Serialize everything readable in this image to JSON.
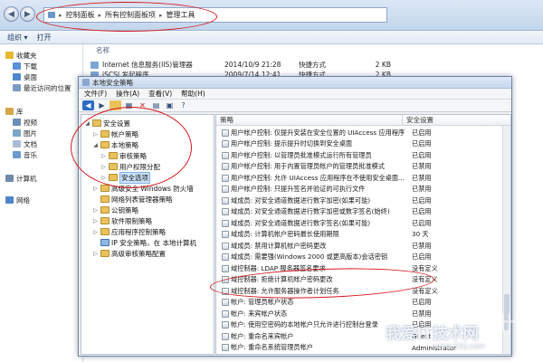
{
  "explorer": {
    "breadcrumb": [
      "控制面板",
      "所有控制面板项",
      "管理工具"
    ],
    "toolbar": {
      "organize": "组织 ▾",
      "open": "打开"
    },
    "nav": [
      {
        "label": "收藏夹",
        "color": "#e6b830"
      },
      {
        "label": "下载",
        "color": "#5b8fd6"
      },
      {
        "label": "桌面",
        "color": "#4f87cc"
      },
      {
        "label": "最近访问的位置",
        "color": "#7a9cc4"
      },
      {
        "label": "库",
        "color": "#d6a64a"
      },
      {
        "label": "视频",
        "color": "#6a8fb8"
      },
      {
        "label": "图片",
        "color": "#7aa6c8"
      },
      {
        "label": "文档",
        "color": "#a9bcd3"
      },
      {
        "label": "音乐",
        "color": "#6b9ad0"
      },
      {
        "label": "计算机",
        "color": "#6f8aa8"
      },
      {
        "label": "网络",
        "color": "#4e86c6"
      }
    ],
    "file_header": "名称",
    "files": [
      {
        "name": "Internet 信息服务(IIS)管理器",
        "date": "2014/10/9 21:28",
        "type": "快捷方式",
        "size": "2 KB"
      },
      {
        "name": "iSCSI 发起程序",
        "date": "2009/7/14 12:41",
        "type": "快捷方式",
        "size": "2 KB"
      }
    ]
  },
  "mmc": {
    "title": "本地安全策略",
    "menu": [
      "文件(F)",
      "操作(A)",
      "查看(V)",
      "帮助(H)"
    ],
    "tree": [
      {
        "label": "安全设置",
        "indent": 0,
        "arrow": "◢"
      },
      {
        "label": "帐户策略",
        "indent": 1,
        "arrow": "▷"
      },
      {
        "label": "本地策略",
        "indent": 1,
        "arrow": "◢"
      },
      {
        "label": "审核策略",
        "indent": 2,
        "arrow": "▷"
      },
      {
        "label": "用户权限分配",
        "indent": 2,
        "arrow": "▷"
      },
      {
        "label": "安全选项",
        "indent": 2,
        "arrow": "▷",
        "selected": true
      },
      {
        "label": "高级安全 Windows 防火墙",
        "indent": 1,
        "arrow": "▷"
      },
      {
        "label": "网络列表管理器策略",
        "indent": 1,
        "arrow": ""
      },
      {
        "label": "公钥策略",
        "indent": 1,
        "arrow": "▷"
      },
      {
        "label": "软件限制策略",
        "indent": 1,
        "arrow": "▷"
      },
      {
        "label": "应用程序控制策略",
        "indent": 1,
        "arrow": "▷"
      },
      {
        "label": "IP 安全策略，在 本地计算机",
        "indent": 1,
        "arrow": "",
        "net": true
      },
      {
        "label": "高级审核策略配置",
        "indent": 1,
        "arrow": "▷"
      }
    ],
    "list_header": {
      "policy": "策略",
      "setting": "安全设置"
    },
    "policies": [
      {
        "name": "用户帐户控制: 仅提升安装在安全位置的 UIAccess 应用程序",
        "setting": "已启用"
      },
      {
        "name": "用户帐户控制: 提示提升时切换到安全桌面",
        "setting": "已启用"
      },
      {
        "name": "用户帐户控制: 以管理员批准模式运行所有管理员",
        "setting": "已启用"
      },
      {
        "name": "用户帐户控制: 用于内置管理员帐户的管理员批准模式",
        "setting": "已禁用"
      },
      {
        "name": "用户帐户控制: 允许 UIAccess 应用程序在不使用安全桌面...",
        "setting": "已禁用"
      },
      {
        "name": "用户帐户控制: 只提升签名并验证的可执行文件",
        "setting": "已禁用"
      },
      {
        "name": "域成员: 对安全通道数据进行数字加密(如果可能)",
        "setting": "已启用"
      },
      {
        "name": "域成员: 对安全通道数据进行数字加密或数字签名(始终)",
        "setting": "已启用"
      },
      {
        "name": "域成员: 对安全通道数据进行数字签名(如果可能)",
        "setting": "已启用"
      },
      {
        "name": "域成员: 计算机帐户密码最长使用期限",
        "setting": "30 天"
      },
      {
        "name": "域成员: 禁用计算机帐户密码更改",
        "setting": "已禁用"
      },
      {
        "name": "域成员: 需要强(Windows 2000 或更高版本)会话密钥",
        "setting": "已启用"
      },
      {
        "name": "域控制器: LDAP 服务器签名要求",
        "setting": "没有定义"
      },
      {
        "name": "域控制器: 拒绝计算机帐户密码更改",
        "setting": "没有定义"
      },
      {
        "name": "域控制器: 允许服务器操作者计划任务",
        "setting": "没有定义"
      },
      {
        "name": "帐户: 管理员帐户状态",
        "setting": "已启用"
      },
      {
        "name": "帐户: 来宾帐户状态",
        "setting": "已禁用"
      },
      {
        "name": "帐户: 使用空密码的本地帐户只允许进行控制台登录",
        "setting": "已启用"
      },
      {
        "name": "帐户: 重命名来宾帐户",
        "setting": "Guest"
      },
      {
        "name": "帐户: 重命名系统管理员帐户",
        "setting": "Administrator"
      }
    ]
  },
  "watermark": {
    "main": "我爱IT技术网",
    "url": "www.52ij.com",
    "mark": "卄"
  },
  "colors": {
    "annotation": "#d8161b",
    "selection": "#cce3fb"
  }
}
